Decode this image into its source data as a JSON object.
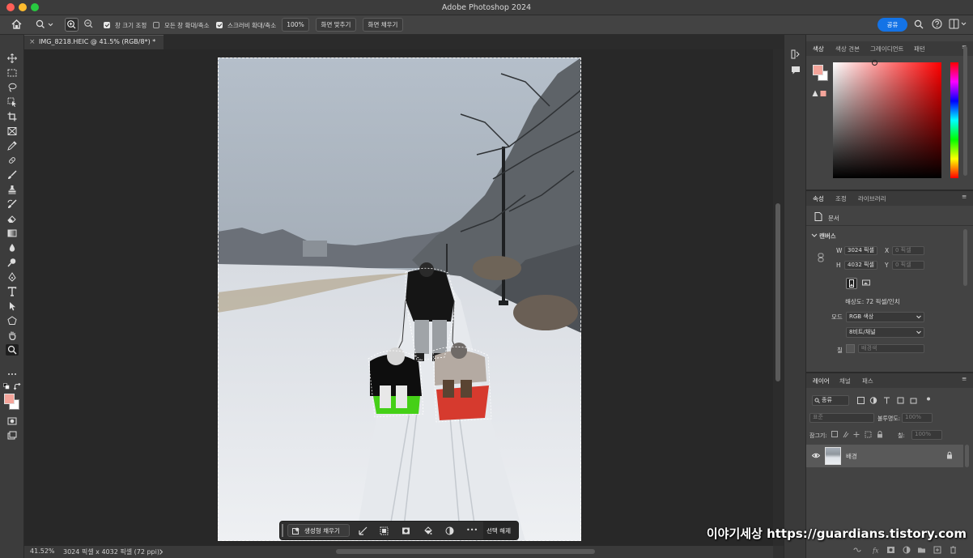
{
  "app_title": "Adobe Photoshop 2024",
  "options": {
    "resize_windows_label": "창 크기 조정",
    "zoom_all_label": "모든 창 확대/축소",
    "scrubby_zoom_label": "스크러비 확대/축소",
    "zoom_value": "100%",
    "fit_screen": "화면 맞추기",
    "fill_screen": "화면 채우기",
    "share": "공유"
  },
  "document_tab": {
    "title": "IMG_8218.HEIC @ 41.5% (RGB/8*) *",
    "close": "×"
  },
  "context_bar": {
    "generative_fill": "생성형 채우기",
    "deselect": "선택 해제",
    "more": "•••"
  },
  "status": {
    "zoom": "41.52%",
    "doc_info": "3024 픽셀 x 4032 픽셀 (72 ppi)"
  },
  "color_panel": {
    "tabs": [
      "색상",
      "색상 견본",
      "그레이디언트",
      "패턴"
    ],
    "foreground": "#f4a49a",
    "background": "#ffffff"
  },
  "properties_panel": {
    "tabs": [
      "속성",
      "조정",
      "라이브러리"
    ],
    "document_label": "문서",
    "canvas_section": "캔버스",
    "w_label": "W",
    "w_value": "3024 픽셀",
    "h_label": "H",
    "h_value": "4032 픽셀",
    "x_label": "X",
    "x_value": "0 픽셀",
    "y_label": "Y",
    "y_value": "0 픽셀",
    "resolution": "해상도: 72 픽셀/인치",
    "mode_label": "모드",
    "mode_value": "RGB 색상",
    "bits_value": "8비트/채널",
    "fill_label": "칠",
    "fill_value": "배경색"
  },
  "layers_panel": {
    "tabs": [
      "레이어",
      "채널",
      "패스"
    ],
    "filter_label": "종류",
    "blend_mode": "표준",
    "opacity_label": "불투명도:",
    "opacity_value": "100%",
    "lock_label": "잠그기:",
    "fill_label": "칠:",
    "fill_value": "100%",
    "layer_name": "배경"
  },
  "watermark": "이야기세상 https://guardians.tistory.com"
}
